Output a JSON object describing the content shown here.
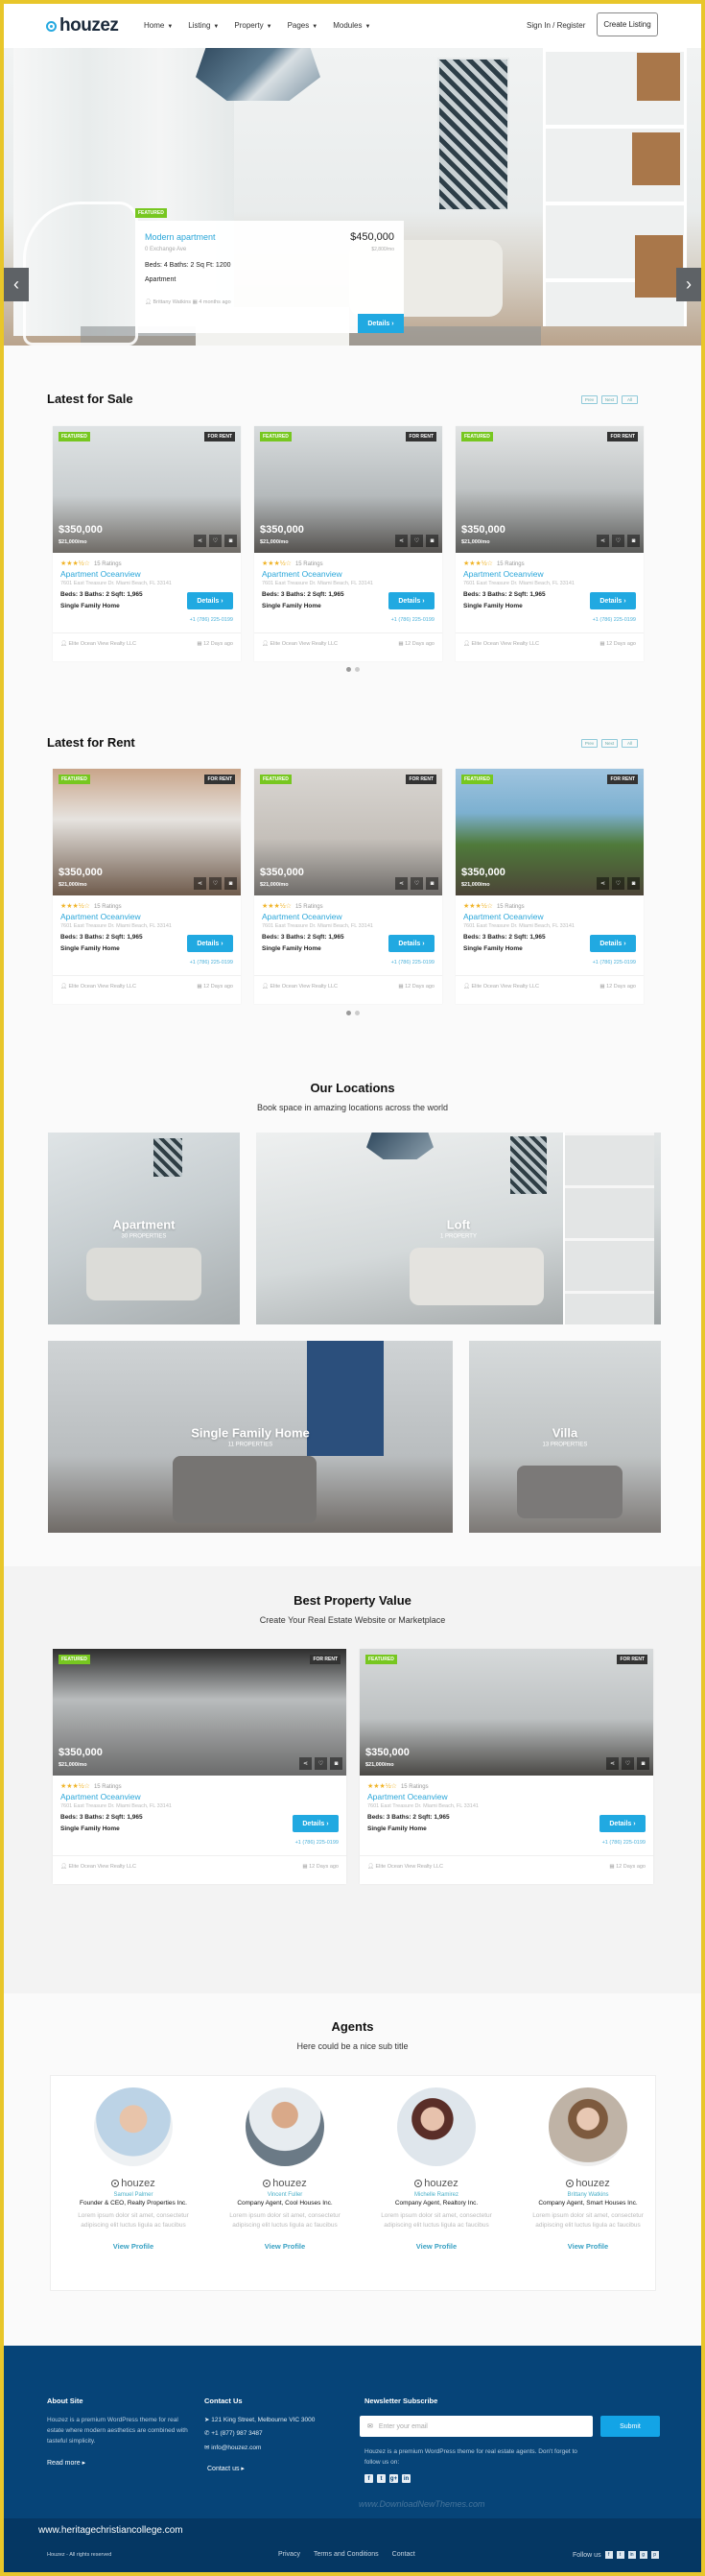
{
  "header": {
    "logo": "houzez",
    "nav": [
      {
        "label": "Home"
      },
      {
        "label": "Listing"
      },
      {
        "label": "Property"
      },
      {
        "label": "Pages"
      },
      {
        "label": "Modules"
      }
    ],
    "signin": "Sign In / Register",
    "create_listing": "Create Listing"
  },
  "hero": {
    "badge": "Featured",
    "title": "Modern apartment",
    "address": "0 Exchange Ave",
    "price": "$450,000",
    "price_sub": "$2,800/mo",
    "specs": "Beds: 4   Baths: 2   Sq Ft: 1200",
    "type": "Apartment",
    "agent": "Brittany Watkins",
    "date": "4 months ago",
    "details_label": "Details",
    "prev_icon": "‹",
    "next_icon": "›"
  },
  "pager": {
    "prev": "Prev",
    "next": "Next",
    "all": "All"
  },
  "sale": {
    "title": "Latest for Sale",
    "cards": [
      {
        "featured": "Featured",
        "status": "For Rent",
        "price": "$350,000",
        "per_month": "$21,000/mo",
        "stars": "★★★½☆",
        "ratings": "15 Ratings",
        "title": "Apartment Oceanview",
        "address": "7601 East Treasure Dr. Miami Beach, FL 33141",
        "specs": "Beds: 3   Baths: 2   Sqft: 1,965",
        "type": "Single Family Home",
        "details": "Details",
        "phone": "+1 (786) 225-0199",
        "agent": "Elite Ocean View Realty LLC",
        "date": "12 Days ago"
      },
      {
        "featured": "Featured",
        "status": "For Rent",
        "price": "$350,000",
        "per_month": "$21,000/mo",
        "stars": "★★★½☆",
        "ratings": "15 Ratings",
        "title": "Apartment Oceanview",
        "address": "7601 East Treasure Dr. Miami Beach, FL 33141",
        "specs": "Beds: 3   Baths: 2   Sqft: 1,965",
        "type": "Single Family Home",
        "details": "Details",
        "phone": "+1 (786) 225-0199",
        "agent": "Elite Ocean View Realty LLC",
        "date": "12 Days ago"
      },
      {
        "featured": "Featured",
        "status": "For Rent",
        "price": "$350,000",
        "per_month": "$21,000/mo",
        "stars": "★★★½☆",
        "ratings": "15 Ratings",
        "title": "Apartment Oceanview",
        "address": "7601 East Treasure Dr. Miami Beach, FL 33141",
        "specs": "Beds: 3   Baths: 2   Sqft: 1,965",
        "type": "Single Family Home",
        "details": "Details",
        "phone": "+1 (786) 225-0199",
        "agent": "Elite Ocean View Realty LLC",
        "date": "12 Days ago"
      }
    ]
  },
  "rent": {
    "title": "Latest for Rent",
    "cards": [
      {
        "featured": "Featured",
        "status": "For Rent",
        "price": "$350,000",
        "per_month": "$21,000/mo",
        "stars": "★★★½☆",
        "ratings": "15 Ratings",
        "title": "Apartment Oceanview",
        "address": "7601 East Treasure Dr. Miami Beach, FL 33141",
        "specs": "Beds: 3   Baths: 2   Sqft: 1,965",
        "type": "Single Family Home",
        "details": "Details",
        "phone": "+1 (786) 225-0199",
        "agent": "Elite Ocean View Realty LLC",
        "date": "12 Days ago"
      },
      {
        "featured": "Featured",
        "status": "For Rent",
        "price": "$350,000",
        "per_month": "$21,000/mo",
        "stars": "★★★½☆",
        "ratings": "15 Ratings",
        "title": "Apartment Oceanview",
        "address": "7601 East Treasure Dr. Miami Beach, FL 33141",
        "specs": "Beds: 3   Baths: 2   Sqft: 1,965",
        "type": "Single Family Home",
        "details": "Details",
        "phone": "+1 (786) 225-0199",
        "agent": "Elite Ocean View Realty LLC",
        "date": "12 Days ago"
      },
      {
        "featured": "Featured",
        "status": "For Rent",
        "price": "$350,000",
        "per_month": "$21,000/mo",
        "stars": "★★★½☆",
        "ratings": "15 Ratings",
        "title": "Apartment Oceanview",
        "address": "7601 East Treasure Dr. Miami Beach, FL 33141",
        "specs": "Beds: 3   Baths: 2   Sqft: 1,965",
        "type": "Single Family Home",
        "details": "Details",
        "phone": "+1 (786) 225-0199",
        "agent": "Elite Ocean View Realty LLC",
        "date": "12 Days ago"
      }
    ]
  },
  "locations": {
    "title": "Our Locations",
    "subtitle": "Book space in amazing locations across the world",
    "items": [
      {
        "name": "Apartment",
        "count": "30 Properties"
      },
      {
        "name": "Loft",
        "count": "1 Property"
      },
      {
        "name": "Single Family Home",
        "count": "11 Properties"
      },
      {
        "name": "Villa",
        "count": "13 Properties"
      }
    ]
  },
  "best": {
    "title": "Best Property Value",
    "subtitle": "Create Your Real Estate Website or Marketplace",
    "cards": [
      {
        "featured": "Featured",
        "status": "For Rent",
        "price": "$350,000",
        "per_month": "$21,000/mo",
        "stars": "★★★½☆",
        "ratings": "15 Ratings",
        "title": "Apartment Oceanview",
        "address": "7601 East Treasure Dr. Miami Beach, FL 33141",
        "specs": "Beds: 3   Baths: 2   Sqft: 1,965",
        "type": "Single Family Home",
        "details": "Details",
        "phone": "+1 (786) 225-0199",
        "agent": "Elite Ocean View Realty LLC",
        "date": "12 Days ago"
      },
      {
        "featured": "Featured",
        "status": "For Rent",
        "price": "$350,000",
        "per_month": "$21,000/mo",
        "stars": "★★★½☆",
        "ratings": "15 Ratings",
        "title": "Apartment Oceanview",
        "address": "7601 East Treasure Dr. Miami Beach, FL 33141",
        "specs": "Beds: 3   Baths: 2   Sqft: 1,965",
        "type": "Single Family Home",
        "details": "Details",
        "phone": "+1 (786) 225-0199",
        "agent": "Elite Ocean View Realty LLC",
        "date": "12 Days ago"
      }
    ]
  },
  "agents": {
    "title": "Agents",
    "subtitle": "Here could be a nice sub title",
    "logo": "houzez",
    "items": [
      {
        "name": "Samuel Palmer",
        "role": "Founder & CEO, Realty Properties Inc.",
        "bio": "Lorem ipsum dolor sit amet, consectetur adipiscing elit luctus ligula ac faucibus",
        "link": "View Profile"
      },
      {
        "name": "Vincent Fuller",
        "role": "Company Agent, Cool Houses Inc.",
        "bio": "Lorem ipsum dolor sit amet, consectetur adipiscing elit luctus ligula ac faucibus",
        "link": "View Profile"
      },
      {
        "name": "Michelle Ramirez",
        "role": "Company Agent, Realtory Inc.",
        "bio": "Lorem ipsum dolor sit amet, consectetur adipiscing elit luctus ligula ac faucibus",
        "link": "View Profile"
      },
      {
        "name": "Brittany Watkins",
        "role": "Company Agent, Smart Houses Inc.",
        "bio": "Lorem ipsum dolor sit amet, consectetur adipiscing elit luctus ligula ac faucibus",
        "link": "View Profile"
      }
    ]
  },
  "footer": {
    "about_title": "About Site",
    "about_text": "Houzez is a premium WordPress theme for real estate where modern aesthetics are combined with tasteful simplicity.",
    "read_more": "Read more ▸",
    "contact_title": "Contact Us",
    "address": "121 King Street, Melbourne VIC 3000",
    "phone": "+1 (877) 987 3487",
    "email": "info@houzez.com",
    "contact_link": "Contact us ▸",
    "newsletter_title": "Newsletter Subscribe",
    "email_placeholder": "Enter your email",
    "submit": "Submit",
    "newsletter_text": "Houzez is a premium WordPress theme for real estate agents. Don't forget to follow us on:",
    "social": [
      "f",
      "t",
      "g+",
      "in"
    ],
    "watermark": "www.DownloadNewThemes.com"
  },
  "bottom": {
    "site_watermark": "www.heritagechristiancollege.com",
    "copyright": "Houzez - All rights reserved",
    "links": [
      "Privacy",
      "Terms and Conditions",
      "Contact"
    ],
    "follow": "Follow us",
    "social": [
      "f",
      "t",
      "in",
      "g",
      "p"
    ]
  }
}
